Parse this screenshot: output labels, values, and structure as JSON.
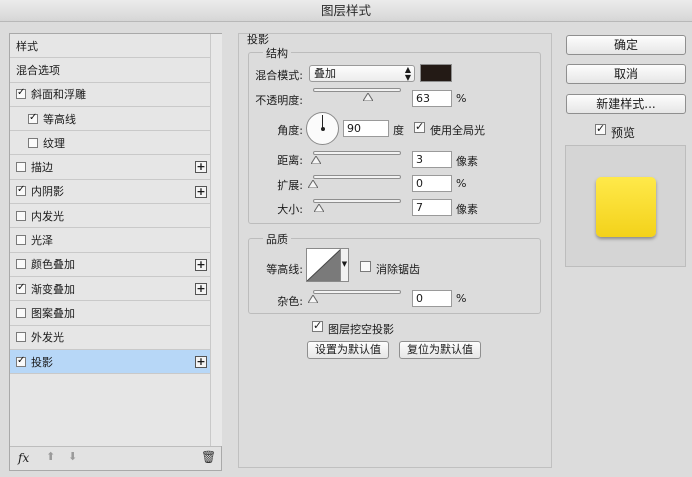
{
  "window": {
    "title": "图层样式"
  },
  "style_list": {
    "items": [
      {
        "label": "样式",
        "checkbox": false,
        "checked": false,
        "plus": false,
        "indent": false,
        "selected": false
      },
      {
        "label": "混合选项",
        "checkbox": false,
        "checked": false,
        "plus": false,
        "indent": false,
        "selected": false
      },
      {
        "label": "斜面和浮雕",
        "checkbox": true,
        "checked": true,
        "plus": false,
        "indent": false,
        "selected": false
      },
      {
        "label": "等高线",
        "checkbox": true,
        "checked": true,
        "plus": false,
        "indent": true,
        "selected": false
      },
      {
        "label": "纹理",
        "checkbox": true,
        "checked": false,
        "plus": false,
        "indent": true,
        "selected": false
      },
      {
        "label": "描边",
        "checkbox": true,
        "checked": false,
        "plus": true,
        "indent": false,
        "selected": false
      },
      {
        "label": "内阴影",
        "checkbox": true,
        "checked": true,
        "plus": true,
        "indent": false,
        "selected": false
      },
      {
        "label": "内发光",
        "checkbox": true,
        "checked": false,
        "plus": false,
        "indent": false,
        "selected": false
      },
      {
        "label": "光泽",
        "checkbox": true,
        "checked": false,
        "plus": false,
        "indent": false,
        "selected": false
      },
      {
        "label": "颜色叠加",
        "checkbox": true,
        "checked": false,
        "plus": true,
        "indent": false,
        "selected": false
      },
      {
        "label": "渐变叠加",
        "checkbox": true,
        "checked": true,
        "plus": true,
        "indent": false,
        "selected": false
      },
      {
        "label": "图案叠加",
        "checkbox": true,
        "checked": false,
        "plus": false,
        "indent": false,
        "selected": false
      },
      {
        "label": "外发光",
        "checkbox": true,
        "checked": false,
        "plus": false,
        "indent": false,
        "selected": false
      },
      {
        "label": "投影",
        "checkbox": true,
        "checked": true,
        "plus": true,
        "indent": false,
        "selected": true
      }
    ],
    "footer": {
      "fx_label": "fx",
      "up_icon": "arrow-up-icon",
      "down_icon": "arrow-down-icon",
      "trash_icon": "trash-icon"
    }
  },
  "drop_shadow": {
    "section_title": "投影",
    "structure": {
      "title": "结构",
      "blend_mode_label": "混合模式:",
      "blend_mode_value": "叠加",
      "shadow_color": "#231a15",
      "opacity_label": "不透明度:",
      "opacity_value": "63",
      "opacity_unit": "%",
      "opacity_fraction": 0.63,
      "angle_label": "角度:",
      "angle_value": "90",
      "angle_unit": "度",
      "global_light_label": "使用全局光",
      "global_light_checked": true,
      "distance_label": "距离:",
      "distance_value": "3",
      "distance_unit": "像素",
      "distance_fraction": 0.03,
      "spread_label": "扩展:",
      "spread_value": "0",
      "spread_unit": "%",
      "spread_fraction": 0.0,
      "size_label": "大小:",
      "size_value": "7",
      "size_unit": "像素",
      "size_fraction": 0.07
    },
    "quality": {
      "title": "品质",
      "contour_label": "等高线:",
      "anti_alias_label": "消除锯齿",
      "anti_alias_checked": false,
      "noise_label": "杂色:",
      "noise_value": "0",
      "noise_unit": "%",
      "noise_fraction": 0.0
    },
    "knockout_label": "图层挖空投影",
    "knockout_checked": true,
    "make_default_label": "设置为默认值",
    "reset_default_label": "复位为默认值"
  },
  "actions": {
    "ok_label": "确定",
    "cancel_label": "取消",
    "new_style_label": "新建样式...",
    "preview_label": "预览",
    "preview_checked": true,
    "preview_color": "#f6dc2c"
  }
}
